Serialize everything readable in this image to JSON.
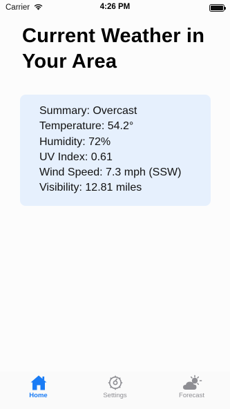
{
  "status_bar": {
    "carrier": "Carrier",
    "time": "4:26 PM"
  },
  "title": "Current Weather in Your Area",
  "weather": {
    "rows": [
      "Summary: Overcast",
      "Temperature: 54.2°",
      "Humidity: 72%",
      "UV Index: 0.61",
      "Wind Speed: 7.3 mph (SSW)",
      "Visibility: 12.81 miles"
    ]
  },
  "tabs": [
    {
      "label": "Home",
      "icon": "home-icon",
      "active": true
    },
    {
      "label": "Settings",
      "icon": "gear-icon",
      "active": false
    },
    {
      "label": "Forecast",
      "icon": "cloud-sun-icon",
      "active": false
    }
  ],
  "colors": {
    "accent": "#1a7cf5",
    "card_background": "#e6f0fd",
    "inactive_tab": "#8e8e93"
  }
}
